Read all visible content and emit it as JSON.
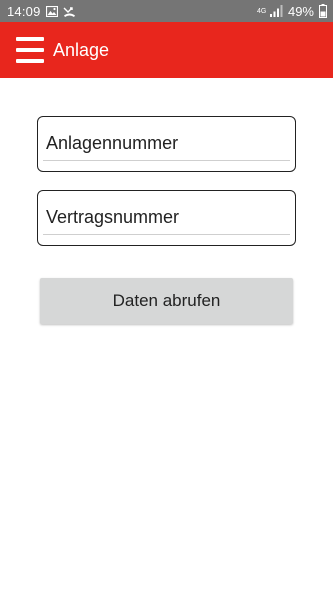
{
  "status_bar": {
    "time": "14:09",
    "network_label": "4G",
    "battery_percent": "49%",
    "icons": [
      "image-icon",
      "missed-call-icon",
      "signal-icon",
      "battery-icon"
    ]
  },
  "app_bar": {
    "title": "Anlage",
    "menu_icon": "hamburger-menu-icon",
    "background_color": "#e8261d"
  },
  "form": {
    "anlagennummer": {
      "value": "",
      "placeholder": "Anlagennummer"
    },
    "vertragsnummer": {
      "value": "",
      "placeholder": "Vertragsnummer"
    },
    "submit_label": "Daten abrufen"
  }
}
